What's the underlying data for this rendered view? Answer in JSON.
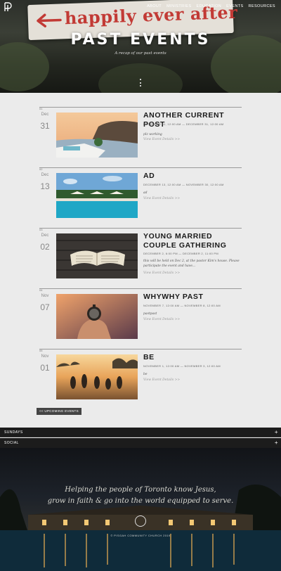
{
  "nav": {
    "items": [
      "ABOUT",
      "MINISTRIES",
      "EDUCATION",
      "EVENTS",
      "RESOURCES"
    ]
  },
  "hero": {
    "sign_text": "happily ever after",
    "title": "PAST EVENTS",
    "subtitle": "A recap of our past events"
  },
  "events": [
    {
      "num": "01",
      "month": "Dec",
      "day": "31",
      "title": "ANOTHER CURRENT POST",
      "date": "DECEMBER 31, 12:00 AM — DECEMBER 31, 12:00 AM",
      "desc": "plz working",
      "more": "View Event Details >>"
    },
    {
      "num": "02",
      "month": "Dec",
      "day": "13",
      "title": "AD",
      "date": "DECEMBER 13, 12:00 AM — NOVEMBER 30, 12:00 AM",
      "desc": "ad",
      "more": "View Event Details >>"
    },
    {
      "num": "03",
      "month": "Dec",
      "day": "02",
      "title": "YOUNG MARRIED COUPLE GATHERING",
      "date": "DECEMBER 2, 6:00 PM — DECEMBER 2, 11:00 PM",
      "desc": "this will be held on Dec 2, at the pastor Kim's house. Please participate the event and have...",
      "more": "View Event Details >>"
    },
    {
      "num": "04",
      "month": "Nov",
      "day": "07",
      "title": "WHYWHY PAST",
      "date": "NOVEMBER 7, 12:00 AM — NOVEMBER 8, 12:00 AM",
      "desc": "pastpast",
      "more": "View Event Details >>"
    },
    {
      "num": "05",
      "month": "Nov",
      "day": "01",
      "title": "BE",
      "date": "NOVEMBER 1, 12:00 AM — NOVEMBER 3, 12:00 AM",
      "desc": "be",
      "more": "View Event Details >>"
    }
  ],
  "upcoming_label": "<< UPCOMING EVENTS",
  "footer": {
    "bars": [
      "SUNDAYS",
      "SOCIAL"
    ],
    "tagline_1": "Helping the people of Toronto know Jesus,",
    "tagline_2": "grow in faith & go into the world equipped to serve.",
    "copyright": "© PISGAH COMMUNITY CHURCH 2019"
  },
  "colors": {
    "accent_sign": "#c23a35",
    "page_bg": "#ebebeb",
    "dark_bar": "#1c1c1c"
  }
}
